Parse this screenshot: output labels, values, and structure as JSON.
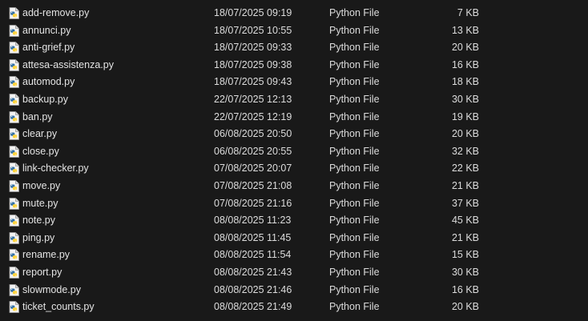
{
  "files": [
    {
      "name": "add-remove.py",
      "date": "18/07/2025 09:19",
      "type": "Python File",
      "size": "7 KB"
    },
    {
      "name": "annunci.py",
      "date": "18/07/2025 10:55",
      "type": "Python File",
      "size": "13 KB"
    },
    {
      "name": "anti-grief.py",
      "date": "18/07/2025 09:33",
      "type": "Python File",
      "size": "20 KB"
    },
    {
      "name": "attesa-assistenza.py",
      "date": "18/07/2025 09:38",
      "type": "Python File",
      "size": "16 KB"
    },
    {
      "name": "automod.py",
      "date": "18/07/2025 09:43",
      "type": "Python File",
      "size": "18 KB"
    },
    {
      "name": "backup.py",
      "date": "22/07/2025 12:13",
      "type": "Python File",
      "size": "30 KB"
    },
    {
      "name": "ban.py",
      "date": "22/07/2025 12:19",
      "type": "Python File",
      "size": "19 KB"
    },
    {
      "name": "clear.py",
      "date": "06/08/2025 20:50",
      "type": "Python File",
      "size": "20 KB"
    },
    {
      "name": "close.py",
      "date": "06/08/2025 20:55",
      "type": "Python File",
      "size": "32 KB"
    },
    {
      "name": "link-checker.py",
      "date": "07/08/2025 20:07",
      "type": "Python File",
      "size": "22 KB"
    },
    {
      "name": "move.py",
      "date": "07/08/2025 21:08",
      "type": "Python File",
      "size": "21 KB"
    },
    {
      "name": "mute.py",
      "date": "07/08/2025 21:16",
      "type": "Python File",
      "size": "37 KB"
    },
    {
      "name": "note.py",
      "date": "08/08/2025 11:23",
      "type": "Python File",
      "size": "45 KB"
    },
    {
      "name": "ping.py",
      "date": "08/08/2025 11:45",
      "type": "Python File",
      "size": "21 KB"
    },
    {
      "name": "rename.py",
      "date": "08/08/2025 11:54",
      "type": "Python File",
      "size": "15 KB"
    },
    {
      "name": "report.py",
      "date": "08/08/2025 21:43",
      "type": "Python File",
      "size": "30 KB"
    },
    {
      "name": "slowmode.py",
      "date": "08/08/2025 21:46",
      "type": "Python File",
      "size": "16 KB"
    },
    {
      "name": "ticket_counts.py",
      "date": "08/08/2025 21:49",
      "type": "Python File",
      "size": "20 KB"
    }
  ],
  "icon": "python-file-icon",
  "colors": {
    "background": "#191919",
    "text": "#dcdcdc",
    "python_blue": "#3572A5",
    "python_yellow": "#FFD43B"
  }
}
